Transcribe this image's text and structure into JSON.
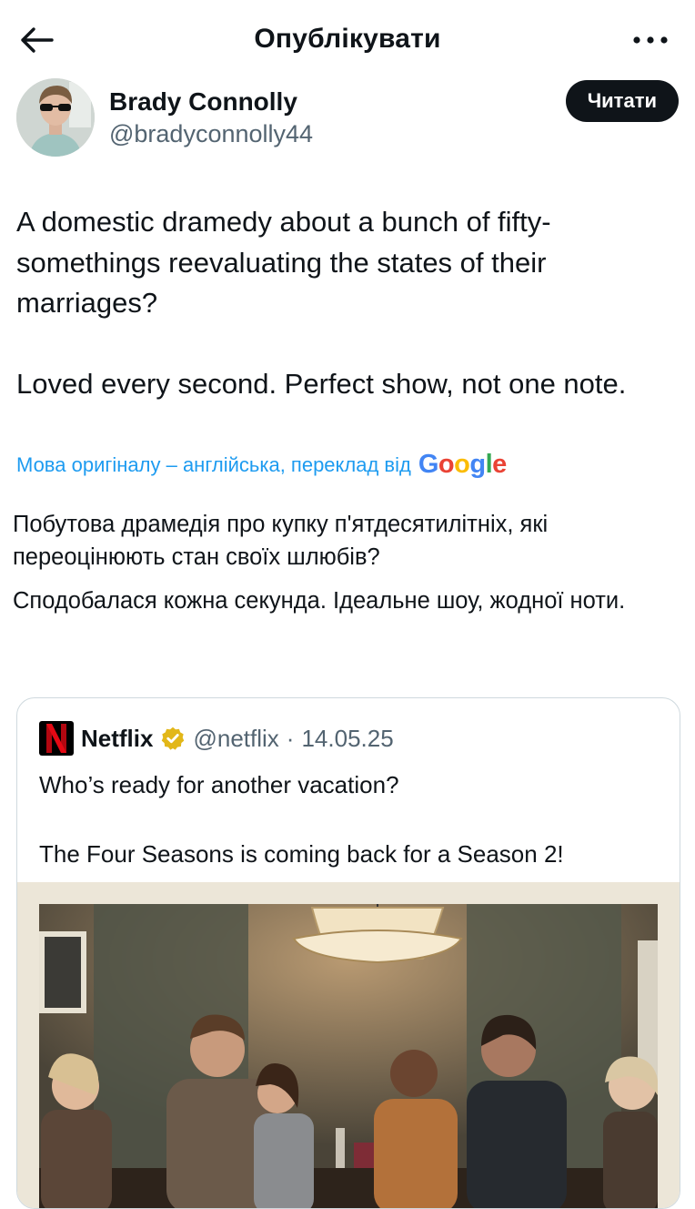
{
  "header": {
    "title": "Опублікувати",
    "back_icon": "arrow-left-icon",
    "more_icon": "more-horizontal-icon"
  },
  "author": {
    "name": "Brady Connolly",
    "handle": "@bradyconnolly44",
    "follow_label": "Читати"
  },
  "tweet": {
    "paragraphs": [
      "A domestic dramedy about a bunch of fifty-somethings reevaluating the states of their marriages?",
      "Loved every second. Perfect show, not one note."
    ]
  },
  "translation": {
    "note": "Мова оригіналу – англійська, переклад від",
    "provider": "Google",
    "paragraphs": [
      "Побутова драмедія про купку п'ятдесятилітніх, які переоцінюють стан своїх шлюбів?",
      "Сподобалася кожна секунда. Ідеальне шоу, жодної ноти."
    ]
  },
  "quoted_tweet": {
    "name": "Netflix",
    "handle": "@netflix",
    "separator": "·",
    "date": "14.05.25",
    "verified_icon": "verified-badge-icon",
    "paragraphs": [
      "Who’s ready for another vacation?",
      "The Four Seasons is coming back for a Season 2!"
    ]
  },
  "colors": {
    "link": "#1d9bf0",
    "secondary_text": "#536471",
    "verified": "#e2b719",
    "netflix_red": "#e50914"
  }
}
